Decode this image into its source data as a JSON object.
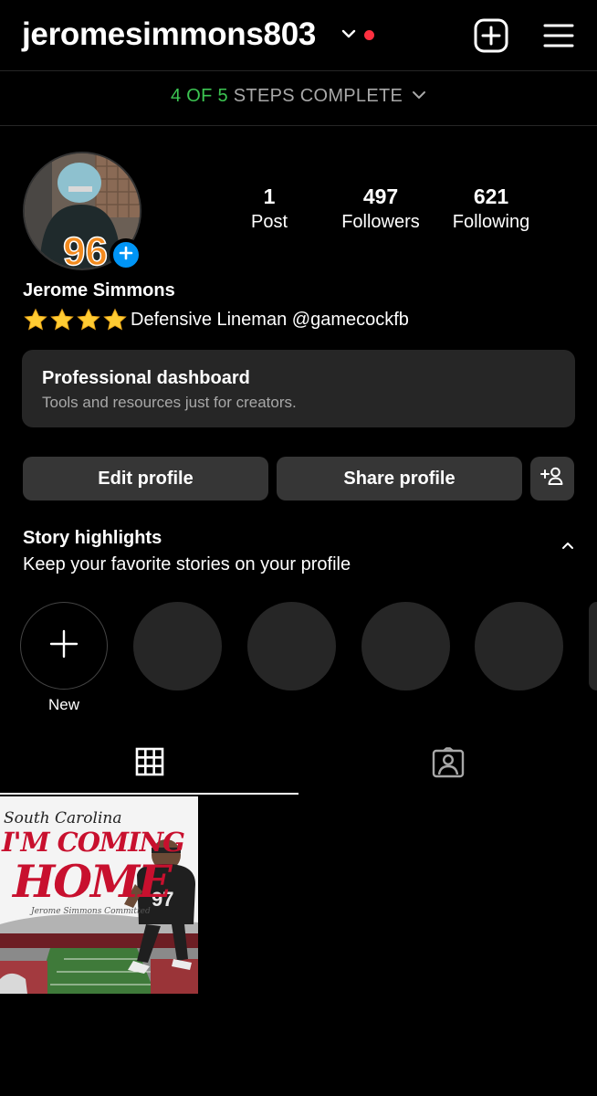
{
  "header": {
    "username": "jeromesimmons803",
    "notification_color": "#ff3040"
  },
  "steps": {
    "progress": "4 OF 5",
    "label": "STEPS COMPLETE",
    "progress_color": "#3cc552"
  },
  "profile": {
    "stats": [
      {
        "value": "1",
        "label": "Post"
      },
      {
        "value": "497",
        "label": "Followers"
      },
      {
        "value": "621",
        "label": "Following"
      }
    ],
    "name": "Jerome Simmons",
    "bio_stars": 4,
    "bio_text": "Defensive Lineman @gamecockfb"
  },
  "dashboard": {
    "title": "Professional dashboard",
    "subtitle": "Tools and resources just for creators."
  },
  "actions": {
    "edit": "Edit profile",
    "share": "Share profile"
  },
  "highlights": {
    "title": "Story highlights",
    "subtitle": "Keep your favorite stories on your profile",
    "new_label": "New"
  },
  "post": {
    "script_text": "South Carolina",
    "headline_1": "I'M COMING",
    "headline_2": "HOME",
    "signature": "Jerome Simmons Committed",
    "accent_color": "#c8102e"
  },
  "accent_blue": "#0095f6",
  "icons": [
    "chevron-down-icon",
    "add-post-icon",
    "menu-icon",
    "plus-icon",
    "star-icon",
    "add-person-icon",
    "chevron-up-icon",
    "grid-icon",
    "tagged-icon"
  ]
}
